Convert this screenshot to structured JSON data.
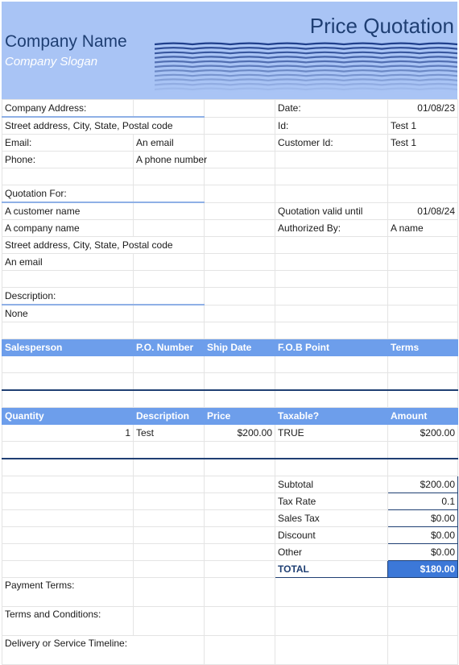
{
  "header": {
    "company_name": "Company Name",
    "company_slogan": "Company Slogan",
    "title": "Price Quotation"
  },
  "company": {
    "address_label": "Company Address:",
    "street": "Street address, City, State, Postal code",
    "email_label": "Email:",
    "email": "An email",
    "phone_label": "Phone:",
    "phone": "A phone number"
  },
  "meta": {
    "date_label": "Date:",
    "date": "01/08/23",
    "id_label": "Id:",
    "id": "Test 1",
    "customer_id_label": "Customer Id:",
    "customer_id": "Test 1",
    "valid_label": "Quotation valid until",
    "valid_until": "01/08/24",
    "authorized_label": "Authorized By:",
    "authorized_by": "A name"
  },
  "quotation_for": {
    "label": "Quotation For:",
    "customer": "A customer name",
    "company": "A company name",
    "street": "Street address, City, State, Postal code",
    "email": "An email"
  },
  "description": {
    "label": "Description:",
    "value": "None"
  },
  "sales_headers": [
    "Salesperson",
    "P.O. Number",
    "Ship Date",
    "F.O.B Point",
    "Terms"
  ],
  "item_headers": [
    "Quantity",
    "Description",
    "Price",
    "Taxable?",
    "Amount"
  ],
  "items": [
    {
      "quantity": "1",
      "description": "Test",
      "price": "$200.00",
      "taxable": "TRUE",
      "amount": "$200.00"
    }
  ],
  "totals": {
    "subtotal_label": "Subtotal",
    "subtotal": "$200.00",
    "tax_rate_label": "Tax Rate",
    "tax_rate": "0.1",
    "sales_tax_label": "Sales Tax",
    "sales_tax": "$0.00",
    "discount_label": "Discount",
    "discount": "$0.00",
    "other_label": "Other",
    "other": "$0.00",
    "total_label": "TOTAL",
    "total": "$180.00"
  },
  "footer": {
    "payment_terms_label": "Payment Terms:",
    "terms_label": "Terms and Conditions:",
    "delivery_label": "Delivery or Service Timeline:"
  },
  "colors": {
    "header_bg": "#a9c4f5",
    "band_bg": "#6d9eeb",
    "title_text": "#1f3f73",
    "total_bg": "#3c78d8"
  }
}
